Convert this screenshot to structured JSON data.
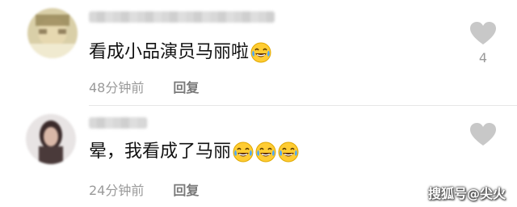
{
  "comments": [
    {
      "text": "看成小品演员马丽啦",
      "emoji_count": 1,
      "emoji": "laughing-tears-emoji",
      "time": "48分钟前",
      "reply": "回复",
      "likes": "4"
    },
    {
      "text": "晕，我看成了马丽",
      "emoji_count": 3,
      "emoji": "laughing-tears-emoji",
      "time": "24分钟前",
      "reply": "回复",
      "likes": ""
    }
  ],
  "watermark": "搜狐号@尖火",
  "colors": {
    "meta_text": "#9a9a9a",
    "like_icon": "#c8c8c8",
    "emoji_face": "#ffcc33"
  }
}
